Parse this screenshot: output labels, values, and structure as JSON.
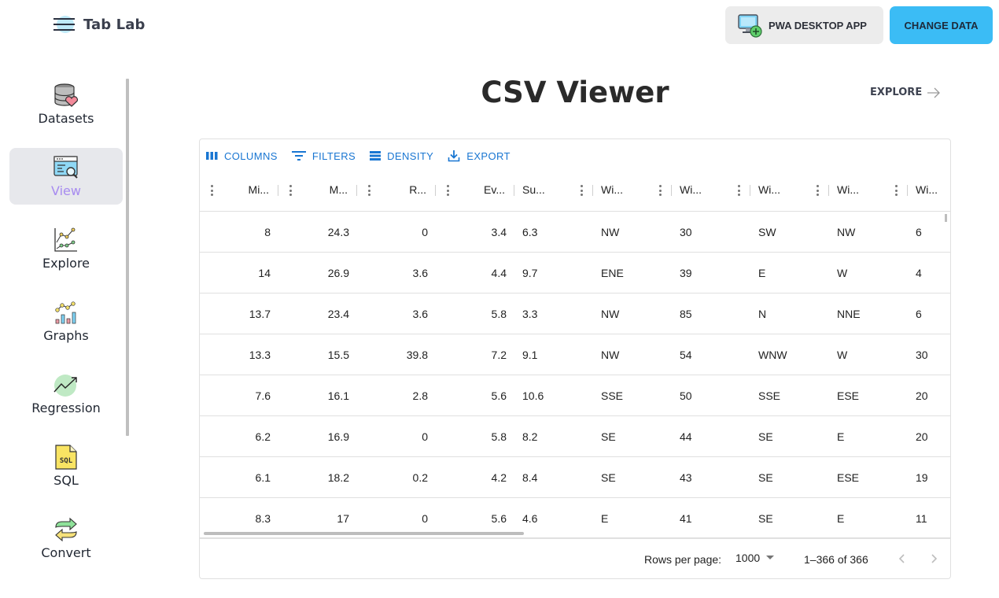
{
  "app": {
    "title": "Tab Lab",
    "menu_icon": "hamburger-menu-icon"
  },
  "header": {
    "pwa_button": {
      "label": "PWA DESKTOP APP",
      "icon": "desktop-add-icon"
    },
    "change_data_button": {
      "label": "CHANGE DATA"
    }
  },
  "colors": {
    "accent_blue": "#3bbcf5",
    "grid_blue": "#1976d2",
    "active_nav_text": "#a78bf0",
    "active_nav_bg": "#e7e8ec"
  },
  "sidebar": {
    "items": [
      {
        "label": "Datasets",
        "icon": "database-heart-icon",
        "active": false
      },
      {
        "label": "View",
        "icon": "window-search-icon",
        "active": true
      },
      {
        "label": "Explore",
        "icon": "line-chart-icon",
        "active": false
      },
      {
        "label": "Graphs",
        "icon": "bar-line-chart-icon",
        "active": false
      },
      {
        "label": "Regression",
        "icon": "trend-up-icon",
        "active": false
      },
      {
        "label": "SQL",
        "icon": "sql-file-icon",
        "active": false
      },
      {
        "label": "Convert",
        "icon": "convert-arrows-icon",
        "active": false
      }
    ]
  },
  "main": {
    "title": "CSV Viewer",
    "explore_link": "EXPLORE"
  },
  "grid": {
    "toolbar": {
      "columns": "COLUMNS",
      "filters": "FILTERS",
      "density": "DENSITY",
      "export": "EXPORT"
    },
    "columns": [
      "Mi...",
      "M...",
      "R...",
      "Ev...",
      "Su...",
      "Wi...",
      "Wi...",
      "Wi...",
      "Wi...",
      "Wi..."
    ],
    "rows": [
      [
        "8",
        "24.3",
        "0",
        "3.4",
        "6.3",
        "NW",
        "30",
        "SW",
        "NW",
        "6"
      ],
      [
        "14",
        "26.9",
        "3.6",
        "4.4",
        "9.7",
        "ENE",
        "39",
        "E",
        "W",
        "4"
      ],
      [
        "13.7",
        "23.4",
        "3.6",
        "5.8",
        "3.3",
        "NW",
        "85",
        "N",
        "NNE",
        "6"
      ],
      [
        "13.3",
        "15.5",
        "39.8",
        "7.2",
        "9.1",
        "NW",
        "54",
        "WNW",
        "W",
        "30"
      ],
      [
        "7.6",
        "16.1",
        "2.8",
        "5.6",
        "10.6",
        "SSE",
        "50",
        "SSE",
        "ESE",
        "20"
      ],
      [
        "6.2",
        "16.9",
        "0",
        "5.8",
        "8.2",
        "SE",
        "44",
        "SE",
        "E",
        "20"
      ],
      [
        "6.1",
        "18.2",
        "0.2",
        "4.2",
        "8.4",
        "SE",
        "43",
        "SE",
        "ESE",
        "19"
      ],
      [
        "8.3",
        "17",
        "0",
        "5.6",
        "4.6",
        "E",
        "41",
        "SE",
        "E",
        "11"
      ]
    ],
    "footer": {
      "rows_per_page_label": "Rows per page:",
      "rows_per_page_value": "1000",
      "range_text": "1–366 of 366"
    }
  }
}
